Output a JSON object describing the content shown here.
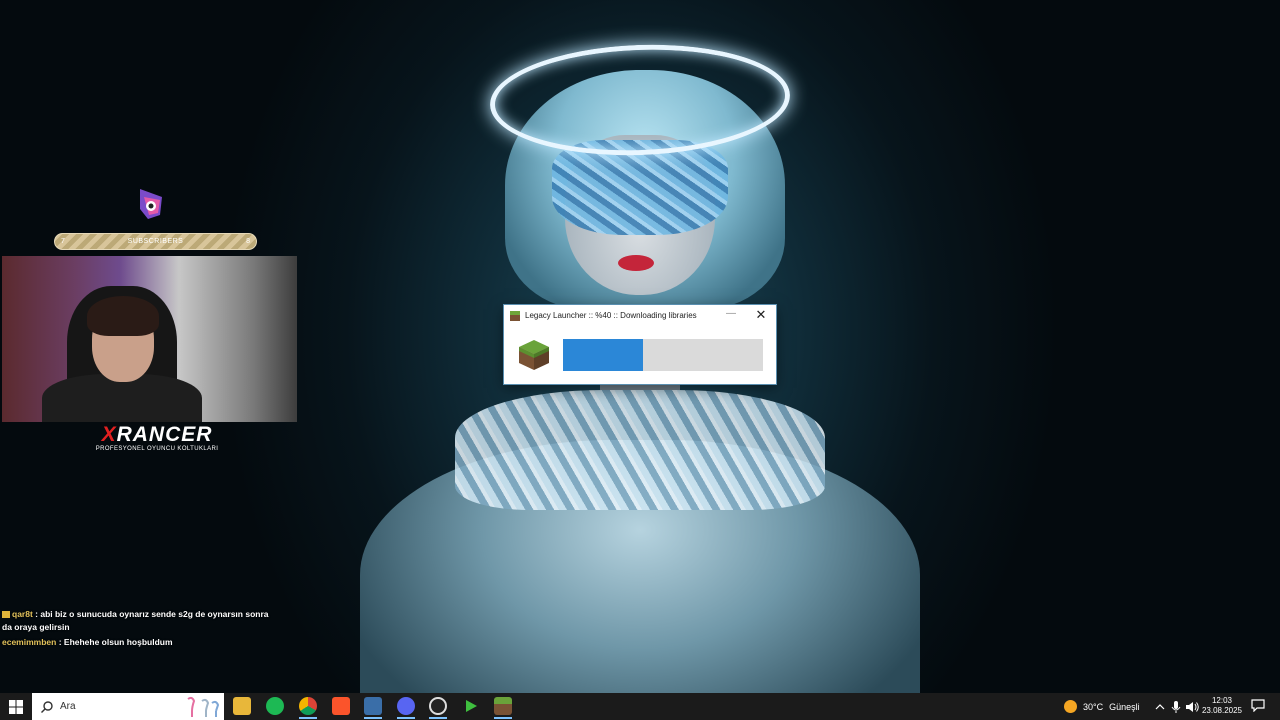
{
  "overlay": {
    "subscribers_label": "SUBSCRIBERS",
    "subscribers_current": "7",
    "subscribers_goal": "8",
    "sponsor_brand": "XRANCER",
    "sponsor_tagline": "PROFESYONEL OYUNCU KOLTUKLARI"
  },
  "chat": [
    {
      "user": "qar8t",
      "text": " : abi biz o sunucuda oynarız sende s2g de oynarsın sonra da oraya gelirsin"
    },
    {
      "user": "ecemimmben",
      "text": " : Ehehehe olsun hoşbuldum"
    }
  ],
  "dialog": {
    "title": "Legacy Launcher :: %40 :: Downloading libraries",
    "minimize": "—",
    "close": "✕",
    "progress": 0.4
  },
  "taskbar": {
    "search_placeholder": "Ara",
    "apps": [
      "file-explorer-icon",
      "spotify-icon",
      "chrome-icon",
      "brave-icon",
      "settings-app-icon",
      "discord-icon",
      "obs-icon",
      "git-icon",
      "minecraft-icon"
    ],
    "weather_temp": "30°C",
    "weather_text": "Güneşli",
    "time": "12:03",
    "date": "23.08.2025"
  }
}
